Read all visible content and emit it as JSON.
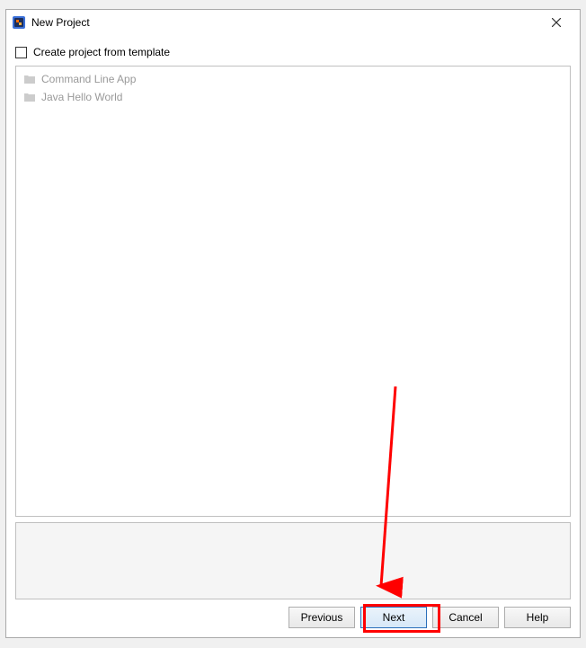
{
  "titlebar": {
    "title": "New Project"
  },
  "content": {
    "checkbox_label": "Create project from template",
    "checkbox_checked": false,
    "templates": [
      {
        "label": "Command Line App"
      },
      {
        "label": "Java Hello World"
      }
    ]
  },
  "buttons": {
    "previous": "Previous",
    "next": "Next",
    "cancel": "Cancel",
    "help": "Help"
  }
}
